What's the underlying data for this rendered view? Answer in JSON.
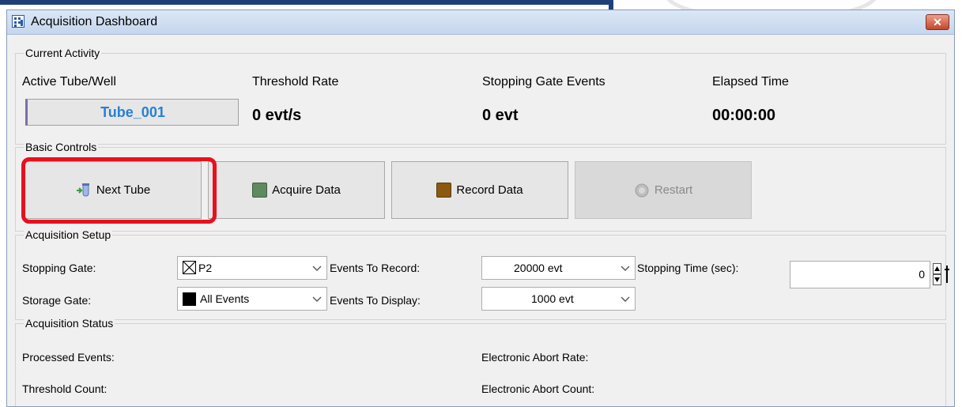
{
  "window": {
    "title": "Acquisition Dashboard",
    "close_icon": "close-icon"
  },
  "current_activity": {
    "label": "Current Activity",
    "headers": {
      "active_tube": "Active Tube/Well",
      "threshold_rate": "Threshold Rate",
      "stopping_gate_events": "Stopping Gate Events",
      "elapsed_time": "Elapsed Time"
    },
    "values": {
      "active_tube": "Tube_001",
      "threshold_rate": "0 evt/s",
      "stopping_gate_events": "0 evt",
      "elapsed_time": "00:00:00"
    }
  },
  "basic_controls": {
    "label": "Basic Controls",
    "next_tube": "Next Tube",
    "acquire_data": "Acquire Data",
    "record_data": "Record Data",
    "restart": "Restart"
  },
  "acquisition_setup": {
    "label": "Acquisition Setup",
    "stopping_gate_label": "Stopping Gate:",
    "stopping_gate_value": "P2",
    "storage_gate_label": "Storage Gate:",
    "storage_gate_value": "All Events",
    "events_to_record_label": "Events To Record:",
    "events_to_record_value": "20000 evt",
    "events_to_display_label": "Events To Display:",
    "events_to_display_value": "1000 evt",
    "stopping_time_label": "Stopping Time (sec):",
    "stopping_time_value": "0"
  },
  "acquisition_status": {
    "label": "Acquisition Status",
    "processed_events": "Processed Events:",
    "threshold_count": "Threshold Count:",
    "electronic_abort_rate": "Electronic Abort Rate:",
    "electronic_abort_count": "Electronic Abort Count:"
  },
  "colors": {
    "accent_blue": "#2a7fd4",
    "highlight_red": "#e8101f",
    "acquire_green": "#5f8a5f",
    "record_brown": "#8a5a12"
  }
}
